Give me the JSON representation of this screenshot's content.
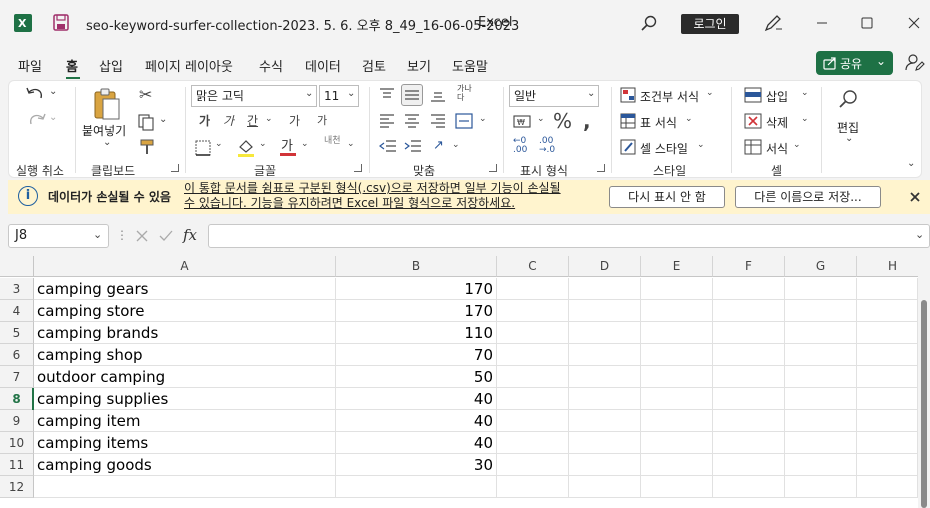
{
  "titlebar": {
    "filename": "seo-keyword-surfer-collection-2023. 5. 6. 오후 8_49_16-06-05-2023",
    "app": "Excel",
    "login": "로그인"
  },
  "menu": [
    "파일",
    "홈",
    "삽입",
    "페이지 레이아웃",
    "수식",
    "데이터",
    "검토",
    "보기",
    "도움말"
  ],
  "share": "공유",
  "ribbon": {
    "undo_group": "실행 취소",
    "clipboard": {
      "label": "클립보드",
      "paste": "붙여넣기"
    },
    "font": {
      "label": "글꼴",
      "name": "맑은 고딕",
      "size": "11"
    },
    "align": {
      "label": "맞춤"
    },
    "number": {
      "label": "표시 형식",
      "format": "일반"
    },
    "styles": {
      "label": "스타일",
      "conditional": "조건부 서식",
      "table": "표 서식",
      "cell": "셀 스타일"
    },
    "cells": {
      "label": "셀",
      "insert": "삽입",
      "delete": "삭제",
      "format": "서식"
    },
    "edit": "편집"
  },
  "infobar": {
    "title": "데이터가 손실될 수 있음",
    "message_line1": "이 통합 문서를 쉼표로 구분된 형식(.csv)으로 저장하면 일부 기능이 손실될",
    "message_line2": "수 있습니다. 기능을 유지하려면 Excel 파일 형식으로 저장하세요.",
    "btn_dismiss": "다시 표시 안 함",
    "btn_saveas": "다른 이름으로 저장..."
  },
  "formula": {
    "namebox": "J8",
    "fx": "fx",
    "value": ""
  },
  "columns": [
    "A",
    "B",
    "C",
    "D",
    "E",
    "F",
    "G",
    "H"
  ],
  "rows": [
    {
      "num": "3",
      "a": "camping gears",
      "b": "170"
    },
    {
      "num": "4",
      "a": "camping store",
      "b": "170"
    },
    {
      "num": "5",
      "a": "camping brands",
      "b": "110"
    },
    {
      "num": "6",
      "a": "camping shop",
      "b": "70"
    },
    {
      "num": "7",
      "a": "outdoor camping",
      "b": "50"
    },
    {
      "num": "8",
      "a": "camping supplies",
      "b": "40"
    },
    {
      "num": "9",
      "a": "camping item",
      "b": "40"
    },
    {
      "num": "10",
      "a": "camping items",
      "b": "40"
    },
    {
      "num": "11",
      "a": "camping goods",
      "b": "30"
    },
    {
      "num": "12",
      "a": "",
      "b": ""
    }
  ],
  "selected_row": "8",
  "colors": {
    "accent": "#217346",
    "share": "#1e7145",
    "info_bg": "#fff4ce"
  }
}
